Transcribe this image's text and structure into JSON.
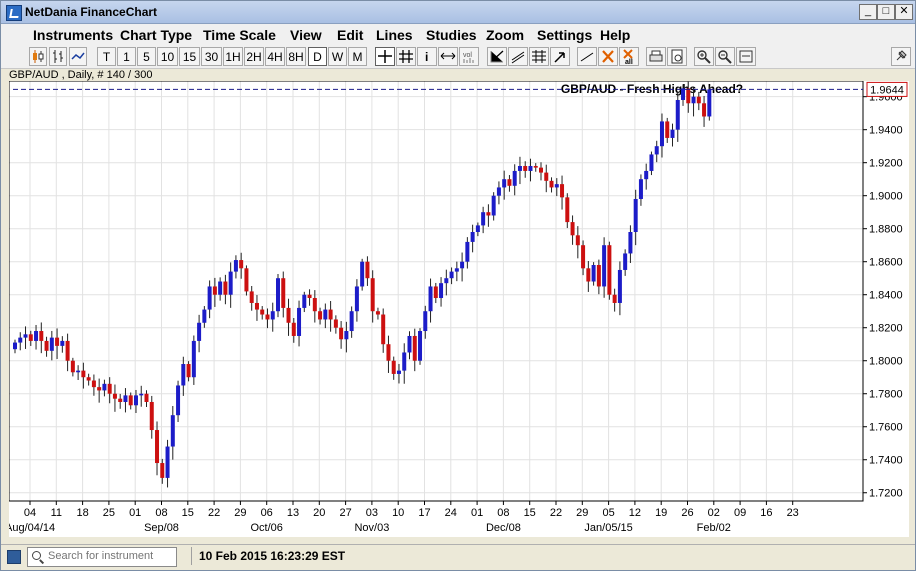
{
  "window": {
    "title": "NetDania FinanceChart",
    "controls": {
      "minimize": "_",
      "maximize": "□",
      "close": "✕"
    }
  },
  "menu": [
    "Instruments",
    "Chart Type",
    "Time Scale",
    "View",
    "Edit",
    "Lines",
    "Studies",
    "Zoom",
    "Settings",
    "Help"
  ],
  "toolbar": {
    "timeframes": [
      "T",
      "1",
      "5",
      "10",
      "15",
      "30",
      "1H",
      "2H",
      "4H",
      "8H",
      "D",
      "W",
      "M"
    ],
    "active_timeframe": "D",
    "vol_label": "vol",
    "all_label": "all"
  },
  "chart_header": "GBP/AUD , Daily, # 140 / 300",
  "status": {
    "search_placeholder": "Search for instrument",
    "datetime": "10 Feb 2015 16:23:29 EST"
  },
  "chart_data": {
    "type": "candlestick",
    "title": "GBP/AUD - Fresh Highs Ahead?",
    "last_price": "1.9644",
    "last_price_value": 1.9644,
    "up_color": "#1c1cc8",
    "down_color": "#cc1010",
    "ylim": [
      1.715,
      1.9695
    ],
    "y_ticks": [
      1.72,
      1.74,
      1.76,
      1.78,
      1.8,
      1.82,
      1.84,
      1.86,
      1.88,
      1.9,
      1.92,
      1.94,
      1.96
    ],
    "y_tick_labels": [
      "1.7200",
      "1.7400",
      "1.7600",
      "1.7800",
      "1.8000",
      "1.8200",
      "1.8400",
      "1.8600",
      "1.8800",
      "1.9000",
      "1.9200",
      "1.9400",
      "1.9600"
    ],
    "x_tick_labels": [
      "04",
      "11",
      "18",
      "25",
      "01",
      "08",
      "15",
      "22",
      "29",
      "06",
      "13",
      "20",
      "27",
      "03",
      "10",
      "17",
      "24",
      "01",
      "08",
      "15",
      "22",
      "29",
      "05",
      "12",
      "19",
      "26",
      "02",
      "09",
      "16",
      "23"
    ],
    "x_month_labels": [
      {
        "text": "Aug/04/14",
        "at_tick": 0
      },
      {
        "text": "Sep/08",
        "at_tick": 5
      },
      {
        "text": "Oct/06",
        "at_tick": 9
      },
      {
        "text": "Nov/03",
        "at_tick": 13
      },
      {
        "text": "Dec/08",
        "at_tick": 18
      },
      {
        "text": "Jan/05/15",
        "at_tick": 22
      },
      {
        "text": "Feb/02",
        "at_tick": 26
      }
    ],
    "grid": true,
    "close_series": [
      1.811,
      1.814,
      1.816,
      1.812,
      1.818,
      1.812,
      1.806,
      1.814,
      1.809,
      1.812,
      1.8,
      1.793,
      1.794,
      1.79,
      1.788,
      1.784,
      1.782,
      1.786,
      1.78,
      1.777,
      1.775,
      1.779,
      1.773,
      1.779,
      1.78,
      1.775,
      1.758,
      1.738,
      1.729,
      1.748,
      1.767,
      1.785,
      1.798,
      1.79,
      1.812,
      1.823,
      1.831,
      1.845,
      1.84,
      1.848,
      1.84,
      1.854,
      1.861,
      1.856,
      1.842,
      1.835,
      1.831,
      1.828,
      1.825,
      1.83,
      1.85,
      1.832,
      1.823,
      1.815,
      1.832,
      1.84,
      1.838,
      1.83,
      1.825,
      1.831,
      1.825,
      1.82,
      1.813,
      1.818,
      1.83,
      1.845,
      1.86,
      1.85,
      1.83,
      1.828,
      1.81,
      1.8,
      1.792,
      1.794,
      1.805,
      1.815,
      1.8,
      1.818,
      1.83,
      1.845,
      1.838,
      1.847,
      1.85,
      1.854,
      1.856,
      1.86,
      1.872,
      1.878,
      1.882,
      1.89,
      1.888,
      1.9,
      1.905,
      1.91,
      1.906,
      1.915,
      1.918,
      1.915,
      1.918,
      1.917,
      1.914,
      1.909,
      1.905,
      1.907,
      1.899,
      1.884,
      1.876,
      1.87,
      1.856,
      1.848,
      1.858,
      1.845,
      1.87,
      1.84,
      1.835,
      1.855,
      1.865,
      1.878,
      1.898,
      1.91,
      1.915,
      1.925,
      1.93,
      1.945,
      1.935,
      1.94,
      1.958,
      1.965,
      1.956,
      1.96,
      1.956,
      1.948,
      1.9644
    ]
  }
}
